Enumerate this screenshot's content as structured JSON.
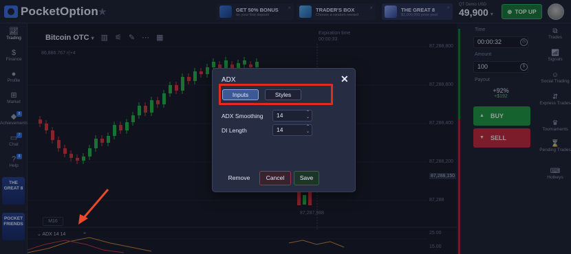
{
  "app": {
    "logo_text": "PocketOption"
  },
  "promos": [
    {
      "title": "GET 50% BONUS",
      "subtitle": "on your first deposit"
    },
    {
      "title": "TRADER'S BOX",
      "subtitle": "Choose a random reward"
    },
    {
      "title": "THE GREAT 8",
      "subtitle": "$1,000,000 prize pool"
    }
  ],
  "account": {
    "label": "QT Demo  USD",
    "balance": "49,900",
    "topup_label": "TOP UP"
  },
  "left_nav": [
    {
      "label": "Trading",
      "icon": "trading-icon"
    },
    {
      "label": "Finance",
      "icon": "dollar-icon"
    },
    {
      "label": "Profile",
      "icon": "person-icon"
    },
    {
      "label": "Market",
      "icon": "cart-icon"
    },
    {
      "label": "Achievements",
      "icon": "diamond-icon",
      "badge": "8"
    },
    {
      "label": "Chat",
      "icon": "chat-icon",
      "badge": "7"
    },
    {
      "label": "Help",
      "icon": "help-icon",
      "badge": "8"
    }
  ],
  "promo_cards": [
    {
      "line1": "THE",
      "line2": "GREAT 8"
    },
    {
      "line1": "POCKET",
      "line2": "FRIENDS"
    }
  ],
  "chart": {
    "asset": "Bitcoin OTC",
    "top_price": "86,886.767 r(+4",
    "expiration_label": "Expiration time",
    "expiration_value": "00:00:33",
    "price_levels": [
      "87,288,800",
      "87,288,600",
      "87,288,400",
      "87,288,200",
      "87,288,150",
      "87,288",
      "87,287,988"
    ],
    "current_price": "87,288,150",
    "timeframe": "M16",
    "indicator_label": "ADX 14 14",
    "indicator_close": "×",
    "sub_axis": [
      "25.00",
      "15.00"
    ]
  },
  "trade_panel": {
    "time_label": "Time",
    "time_value": "00:00:32",
    "amount_label": "Amount",
    "amount_value": "100",
    "payout_label": "Payout",
    "payout_pct": "+92%",
    "payout_amount": "+$192",
    "buy_label": "BUY",
    "sell_label": "SELL"
  },
  "right_nav": [
    {
      "label": "Trades",
      "icon": "trades-icon"
    },
    {
      "label": "Signals",
      "icon": "signals-icon"
    },
    {
      "label": "Social Trading",
      "icon": "social-icon"
    },
    {
      "label": "Express Trades",
      "icon": "express-icon"
    },
    {
      "label": "Tournaments",
      "icon": "trophy-icon"
    },
    {
      "label": "Pending Trades",
      "icon": "pending-icon"
    },
    {
      "label": "Hotkeys",
      "icon": "keyboard-icon"
    }
  ],
  "modal": {
    "title": "ADX",
    "tabs": [
      "Inputs",
      "Styles"
    ],
    "active_tab": "Inputs",
    "fields": [
      {
        "label": "ADX Smoothing",
        "value": "14"
      },
      {
        "label": "DI Length",
        "value": "14"
      }
    ],
    "remove_label": "Remove",
    "cancel_label": "Cancel",
    "save_label": "Save"
  },
  "colors": {
    "accent_blue": "#3c5896",
    "highlight_red": "#e42b20",
    "buy_green": "#1f9a45",
    "sell_red": "#c6283c",
    "candle_green": "#25b34a",
    "candle_red": "#d7343e"
  }
}
